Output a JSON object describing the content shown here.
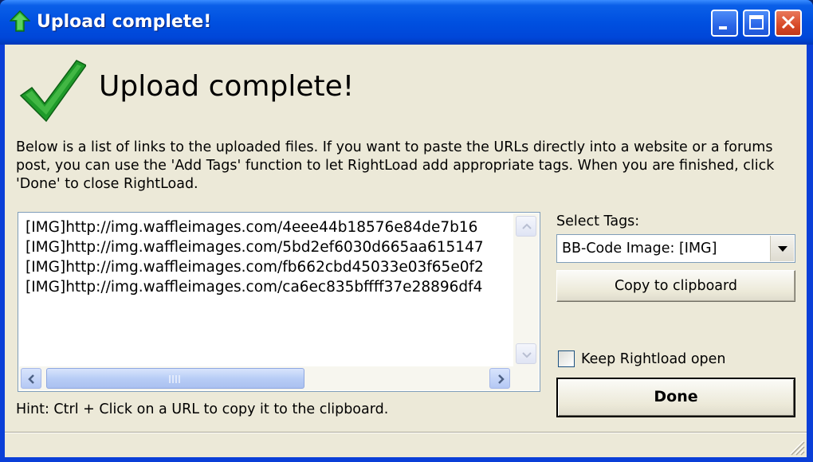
{
  "window": {
    "title": "Upload complete!",
    "colors": {
      "titlebar": "#0050e0",
      "client_bg": "#ece9d8",
      "close_button": "#d84a28"
    }
  },
  "titlebar_controls": [
    "minimize-icon",
    "maximize-icon",
    "close-icon"
  ],
  "main": {
    "heading": "Upload complete!",
    "description": "Below is a list of links to the uploaded files. If you want to paste the URLs directly into a website or a forums post, you can use the 'Add Tags' function to let RightLoad add appropriate tags. When you are finished, click 'Done' to close RightLoad.",
    "links": [
      "[IMG]http://img.waffleimages.com/4eee44b18576e84de7b16",
      "[IMG]http://img.waffleimages.com/5bd2ef6030d665aa615147",
      "[IMG]http://img.waffleimages.com/fb662cbd45033e03f65e0f2",
      "[IMG]http://img.waffleimages.com/ca6ec835bffff37e28896df4"
    ],
    "hint": "Hint: Ctrl + Click on a URL to copy it to the clipboard."
  },
  "side": {
    "select_label": "Select Tags:",
    "select_value": "BB-Code Image: [IMG]",
    "copy_button": "Copy to clipboard",
    "keep_open_label": "Keep Rightload open",
    "keep_open_checked": false,
    "done_button": "Done"
  }
}
